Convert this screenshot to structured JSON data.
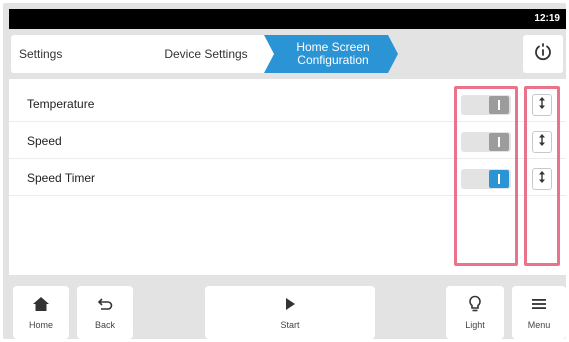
{
  "status_bar": {
    "time": "12:19"
  },
  "breadcrumb": {
    "items": [
      "Settings",
      "Device Settings",
      "Home Screen Configuration"
    ]
  },
  "header": {
    "power_icon": "power-info-icon"
  },
  "settings": {
    "rows": [
      {
        "label": "Temperature",
        "toggle_state": "off"
      },
      {
        "label": "Speed",
        "toggle_state": "off"
      },
      {
        "label": "Speed Timer",
        "toggle_state": "on"
      }
    ]
  },
  "bottom_nav": {
    "home": "Home",
    "back": "Back",
    "start": "Start",
    "light": "Light",
    "menu": "Menu"
  },
  "colors": {
    "accent": "#2b94d5",
    "highlight": "#e8738a",
    "toggle_off_knob": "#9c9c9c"
  }
}
